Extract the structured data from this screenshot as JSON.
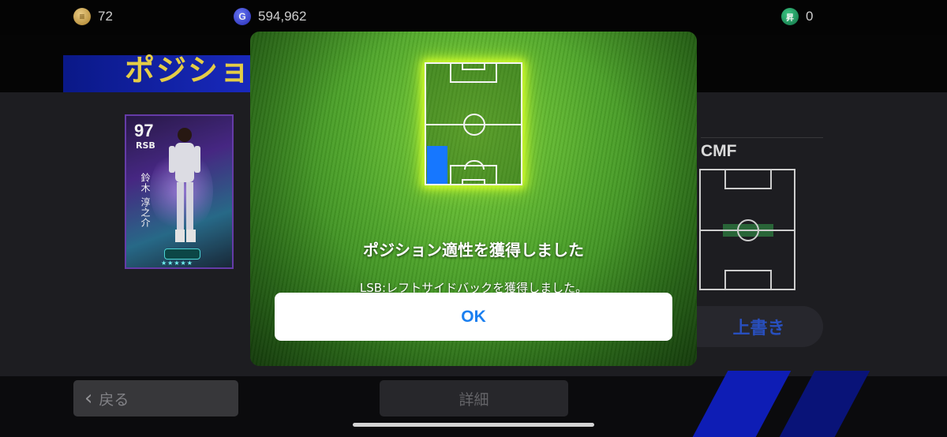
{
  "currency": {
    "coins": {
      "icon": "gold-coin-icon",
      "value": "72"
    },
    "gp": {
      "icon": "gp-icon",
      "glyph": "G",
      "value": "594,962"
    },
    "tickets": {
      "icon": "ticket-icon",
      "glyph": "昇",
      "value": "0"
    }
  },
  "screen": {
    "title": "ポジショ",
    "card": {
      "rating": "97",
      "position": "RSB",
      "name": "鈴木 淳之介",
      "stars": "★★★★★"
    },
    "cmf_label": "CMF",
    "overwrite_label": "上書き",
    "back_label": "戻る",
    "detail_label": "詳細"
  },
  "modal": {
    "title": "ポジション適性を獲得しました",
    "message": "LSB:レフトサイドバックを獲得しました。",
    "ok_label": "OK"
  },
  "colors": {
    "accent_blue": "#1677ff",
    "title_yellow": "#f2d94a",
    "glow": "#d8ff2a"
  }
}
